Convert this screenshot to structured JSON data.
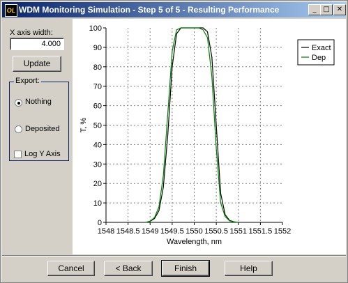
{
  "window": {
    "title": "WDM Monitoring Simulation - Step 5 of 5 - Resulting Performance",
    "icon_text": "OL",
    "icon": "app-icon",
    "controls": {
      "minimize_glyph": "_",
      "maximize_glyph": "□",
      "close_glyph": "✕"
    }
  },
  "left_panel": {
    "xaxis_label": "X axis width:",
    "xaxis_value": "4.000",
    "update_label": "Update",
    "export_label": "Export:",
    "export_options": [
      {
        "label": "Nothing",
        "selected": true
      },
      {
        "label": "Deposited",
        "selected": false
      }
    ],
    "log_y_label": "Log Y Axis",
    "log_y_checked": false
  },
  "chart_data": {
    "type": "line",
    "xlabel": "Wavelength, nm",
    "ylabel": "T, %",
    "xlim": [
      1548,
      1552
    ],
    "ylim": [
      0,
      100
    ],
    "x_ticks": [
      "1548",
      "1548.5",
      "1549",
      "1549.5",
      "1550",
      "1550.5",
      "1551",
      "1551.5",
      "1552"
    ],
    "y_ticks": [
      "0",
      "10",
      "20",
      "30",
      "40",
      "50",
      "60",
      "70",
      "80",
      "90",
      "100"
    ],
    "grid": true,
    "legend_position": "top-right",
    "series": [
      {
        "name": "Exact",
        "color": "#000000",
        "x": [
          1548.9,
          1549.0,
          1549.1,
          1549.2,
          1549.3,
          1549.4,
          1549.5,
          1549.6,
          1549.7,
          1549.8,
          1549.9,
          1550.0,
          1550.1,
          1550.2,
          1550.3,
          1550.4,
          1550.5,
          1550.6,
          1550.7,
          1550.8,
          1550.9,
          1551.0
        ],
        "y": [
          0,
          0.5,
          2,
          6,
          18,
          45,
          80,
          97,
          100,
          100,
          100,
          100,
          100,
          100,
          98,
          85,
          50,
          15,
          4,
          1,
          0.3,
          0
        ]
      },
      {
        "name": "Dep",
        "color": "#008000",
        "x": [
          1548.9,
          1549.0,
          1549.1,
          1549.2,
          1549.3,
          1549.4,
          1549.5,
          1549.6,
          1549.7,
          1549.8,
          1549.9,
          1550.0,
          1550.1,
          1550.2,
          1550.3,
          1550.4,
          1550.5,
          1550.6,
          1550.7,
          1550.8,
          1550.9,
          1551.0
        ],
        "y": [
          0,
          0.6,
          2.5,
          8,
          24,
          56,
          88,
          99,
          100,
          100,
          100,
          100,
          100,
          99,
          95,
          75,
          38,
          10,
          3,
          0.8,
          0.2,
          0
        ]
      }
    ]
  },
  "buttons": {
    "cancel": "Cancel",
    "back": "< Back",
    "finish": "Finish",
    "help": "Help"
  }
}
